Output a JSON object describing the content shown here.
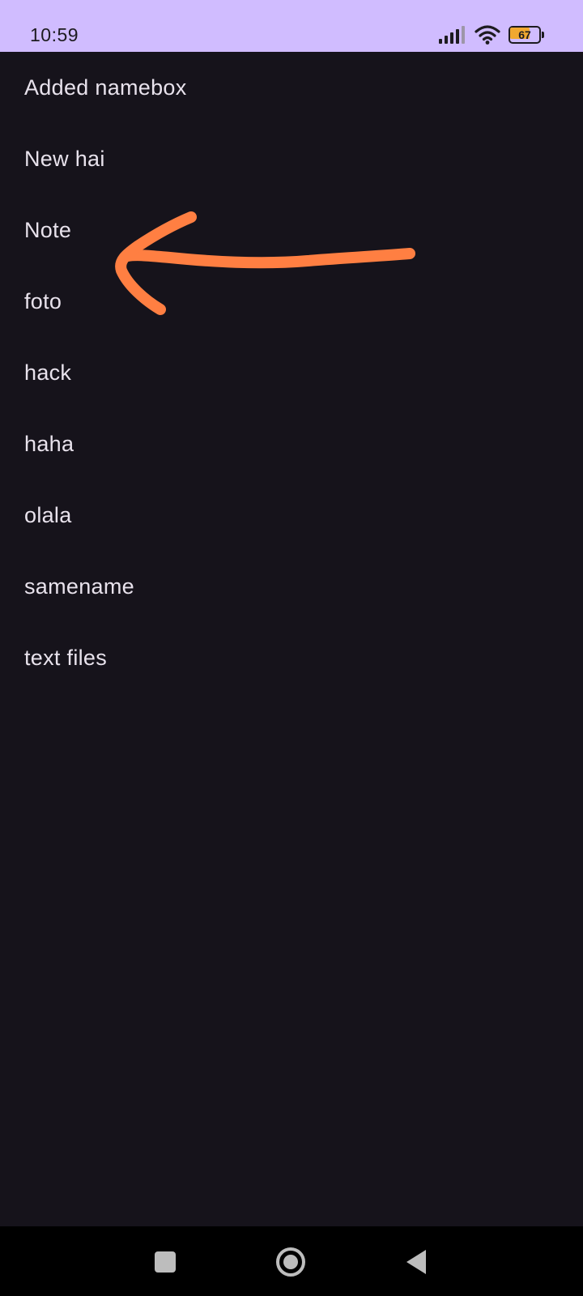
{
  "status_bar": {
    "time": "10:59",
    "battery_level": "67",
    "battery_fraction": 0.67,
    "icons": [
      "signal-icon",
      "wifi-icon",
      "battery-icon"
    ],
    "background_color": "#d0bcff"
  },
  "list": {
    "items": [
      {
        "label": "Added namebox"
      },
      {
        "label": "New hai"
      },
      {
        "label": "Note"
      },
      {
        "label": "foto"
      },
      {
        "label": "hack"
      },
      {
        "label": "haha"
      },
      {
        "label": "olala"
      },
      {
        "label": "samename"
      },
      {
        "label": "text files"
      }
    ]
  },
  "annotation": {
    "type": "hand-drawn-arrow",
    "points_to": "Note",
    "color": "#ff7f42"
  },
  "nav_bar": {
    "buttons": [
      "recents-icon",
      "home-icon",
      "back-icon"
    ]
  },
  "theme": {
    "background": "#16131b",
    "text": "#e8e2ec"
  }
}
